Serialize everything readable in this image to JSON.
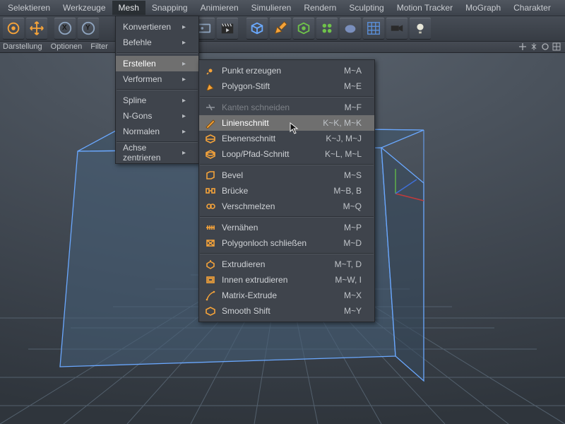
{
  "menubar": {
    "items": [
      "Selektieren",
      "Werkzeuge",
      "Mesh",
      "Snapping",
      "Animieren",
      "Simulieren",
      "Rendern",
      "Sculpting",
      "Motion Tracker",
      "MoGraph",
      "Charakter"
    ],
    "active_index": 2
  },
  "secbar": {
    "items": [
      "Darstellung",
      "Optionen",
      "Filter"
    ]
  },
  "menu1": {
    "items": [
      "Konvertieren",
      "Befehle",
      "__sep",
      "Erstellen",
      "Verformen",
      "__sep",
      "Spline",
      "N-Gons",
      "Normalen",
      "__sep",
      "Achse zentrieren"
    ],
    "hover_index": 3
  },
  "menu2": {
    "items": [
      {
        "label": "Punkt erzeugen",
        "kb": "M~A",
        "icon": "point",
        "disabled": false
      },
      {
        "label": "Polygon-Stift",
        "kb": "M~E",
        "icon": "poly-pen",
        "disabled": false
      },
      "__sep",
      {
        "label": "Kanten schneiden",
        "kb": "M~F",
        "icon": "edge-cut",
        "disabled": true
      },
      {
        "label": "Linienschnitt",
        "kb": "K~K, M~K",
        "icon": "knife",
        "highlight": true
      },
      {
        "label": "Ebenenschnitt",
        "kb": "K~J, M~J",
        "icon": "plane-cut"
      },
      {
        "label": "Loop/Pfad-Schnitt",
        "kb": "K~L, M~L",
        "icon": "loop-cut"
      },
      "__sep",
      {
        "label": "Bevel",
        "kb": "M~S",
        "icon": "bevel"
      },
      {
        "label": "Brücke",
        "kb": "M~B, B",
        "icon": "bridge"
      },
      {
        "label": "Verschmelzen",
        "kb": "M~Q",
        "icon": "weld"
      },
      "__sep",
      {
        "label": "Vernähen",
        "kb": "M~P",
        "icon": "stitch"
      },
      {
        "label": "Polygonloch schließen",
        "kb": "M~D",
        "icon": "close-hole"
      },
      "__sep",
      {
        "label": "Extrudieren",
        "kb": "M~T, D",
        "icon": "extrude"
      },
      {
        "label": "Innen extrudieren",
        "kb": "M~W, I",
        "icon": "inner-ext"
      },
      {
        "label": "Matrix-Extrude",
        "kb": "M~X",
        "icon": "matrix-ext"
      },
      {
        "label": "Smooth Shift",
        "kb": "M~Y",
        "icon": "smooth-shift"
      }
    ]
  },
  "toolbar": {
    "axis": [
      "X",
      "Y"
    ]
  },
  "colors": {
    "orange": "#f5a33a",
    "green": "#6fc24a",
    "blue": "#5a8fd8",
    "steel": "#8fa5c0"
  }
}
